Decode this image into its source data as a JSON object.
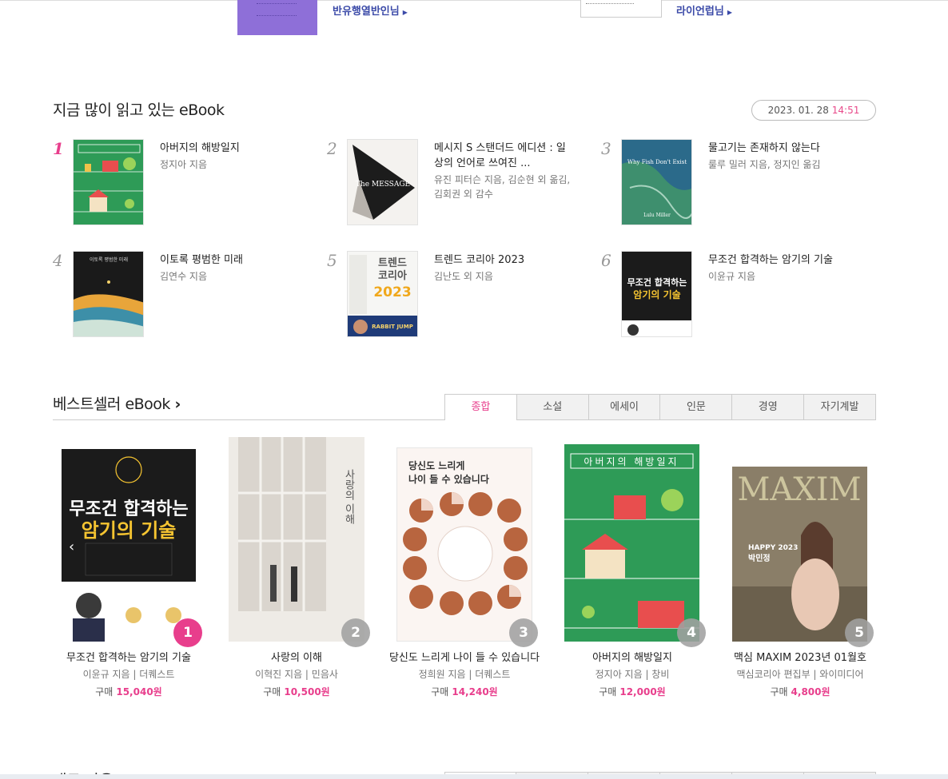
{
  "top": {
    "link1": "반유행열반인님",
    "link2": "라이언럽님",
    "arrow": "▶"
  },
  "popular": {
    "title": "지금 많이 읽고 있는 eBook",
    "date": "2023. 01. 28",
    "time": "14:51",
    "items": [
      {
        "rank": "1",
        "title": "아버지의 해방일지",
        "author": "정지아 지음"
      },
      {
        "rank": "2",
        "title": "메시지 S 스탠더드 에디션 : 일상의 언어로 쓰여진 ...",
        "author": "유진 피터슨 지음, 김순현 외 옮김, 김회권 외 감수"
      },
      {
        "rank": "3",
        "title": "물고기는 존재하지 않는다",
        "author": "룰루 밀러 지음, 정지인 옮김"
      },
      {
        "rank": "4",
        "title": "이토록 평범한 미래",
        "author": "김연수 지음"
      },
      {
        "rank": "5",
        "title": "트렌드 코리아 2023",
        "author": "김난도 외 지음"
      },
      {
        "rank": "6",
        "title": "무조건 합격하는 암기의 기술",
        "author": "이윤규 지음"
      }
    ]
  },
  "bestseller": {
    "title": "베스트셀러 eBook",
    "chevron": "›",
    "tabs": [
      "종합",
      "소설",
      "에세이",
      "인문",
      "경영",
      "자기계발"
    ],
    "price_label": "구매",
    "items": [
      {
        "rank": "1",
        "title": "무조건 합격하는 암기의 기술",
        "author": "이윤규 지음 | 더퀘스트",
        "price": "15,040원"
      },
      {
        "rank": "2",
        "title": "사랑의 이해",
        "author": "이혁진 지음 | 민음사",
        "price": "10,500원"
      },
      {
        "rank": "3",
        "title": "당신도 느리게 나이 들 수 있습니다",
        "author": "정희원 지음 | 더퀘스트",
        "price": "14,240원"
      },
      {
        "rank": "4",
        "title": "아버지의 해방일지",
        "author": "정지아 지음 | 창비",
        "price": "12,000원"
      },
      {
        "rank": "5",
        "title": "맥심 MAXIM 2023년 01월호",
        "author": "맥심코리아 편집부 | 와이미디어",
        "price": "4,800원"
      }
    ]
  },
  "covers": {
    "memory_top": "무조건 합격하는",
    "memory_bottom": "암기의 기술",
    "trend_line1": "트렌드",
    "trend_line2": "코리아",
    "trend_year": "2023",
    "trend_rabbit": "RABBIT JUMP",
    "message": "The MESSAGE",
    "fish_en": "Why Fish Don't Exist",
    "fish_author": "Lulu Miller",
    "future": "이토록 평범한 미래",
    "father": "아버지의 해방일지",
    "love": "사랑의 이해",
    "slow_line1": "당신도 느리게",
    "slow_line2": "나이 들 수 있습니다",
    "maxim": "MAXIM",
    "maxim_happy": "HAPPY 2023",
    "maxim_name": "박민정"
  },
  "bottom": {
    "title": "새로 나온 eBook"
  },
  "colors": {
    "accent": "#e83e8c",
    "link": "#3b4aa8"
  }
}
